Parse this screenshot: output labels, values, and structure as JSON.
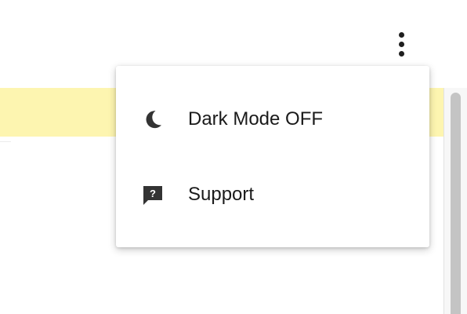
{
  "menu": {
    "items": [
      {
        "label": "Dark Mode OFF",
        "icon": "moon-icon"
      },
      {
        "label": "Support",
        "icon": "support-chat-icon"
      }
    ]
  },
  "toolbar": {
    "more_icon": "more-vert-icon"
  },
  "colors": {
    "highlight_band": "#fdf5b0",
    "icon": "#333333",
    "text": "#1a1a1a",
    "scrollbar_thumb": "#c4c4c4"
  }
}
